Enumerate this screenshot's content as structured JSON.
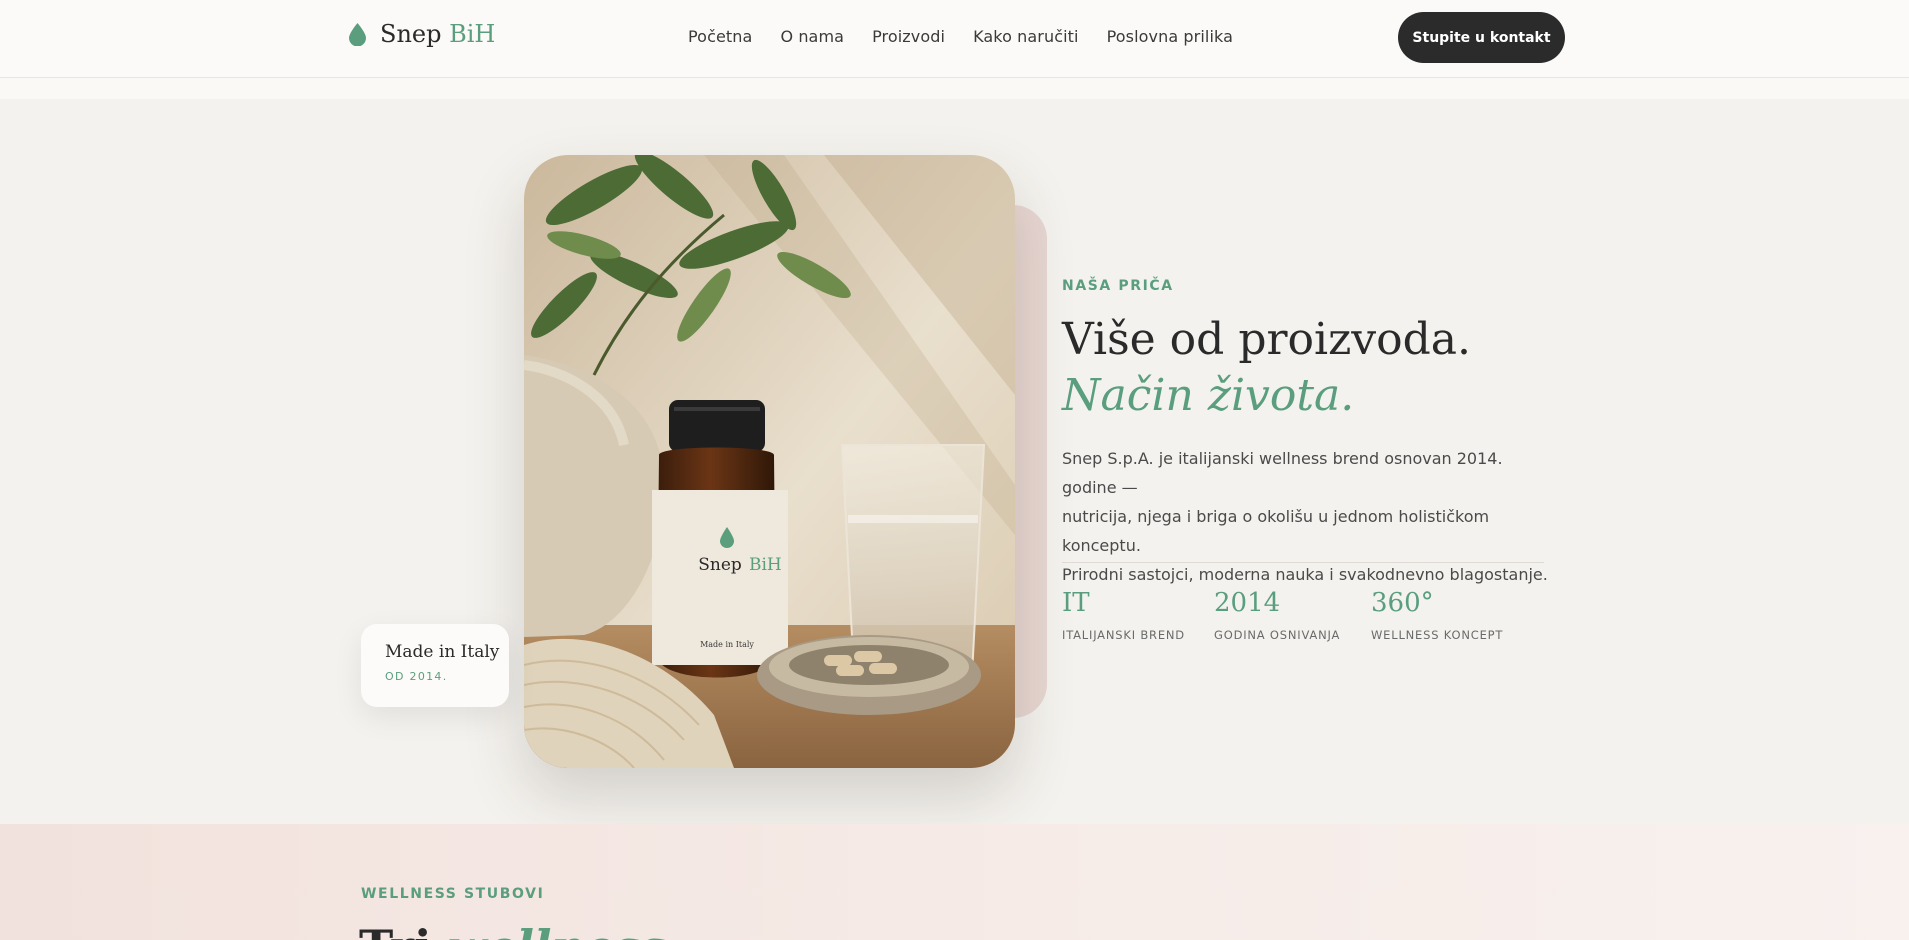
{
  "header": {
    "logo": {
      "name": "Snep",
      "accent": "BiH",
      "icon": "droplet-icon"
    },
    "nav": [
      "Početna",
      "O nama",
      "Proizvodi",
      "Kako naručiti",
      "Poslovna prilika"
    ],
    "cta_label": "Stupite u kontakt"
  },
  "story": {
    "eyebrow": "NAŠA PRIČA",
    "headline_main": "Više od proizvoda.",
    "headline_accent": "Način života.",
    "body_lines": [
      "Snep S.p.A. je italijanski wellness brend osnovan 2014. godine —",
      "nutricija, njega i briga o okolišu u jednom holističkom konceptu.",
      "Prirodni sastojci, moderna nauka i svakodnevno blagostanje."
    ],
    "stats": [
      {
        "value": "IT",
        "label": "ITALIJANSKI BREND"
      },
      {
        "value": "2014",
        "label": "GODINA OSNIVANJA"
      },
      {
        "value": "360°",
        "label": "WELLNESS KONCEPT"
      }
    ],
    "badge": {
      "title": "Made in Italy",
      "subtitle": "OD 2014."
    },
    "photo": {
      "bottle_brand": "Snep",
      "bottle_brand_accent": "BiH",
      "bottle_made_in": "Made in Italy"
    }
  },
  "pillars": {
    "eyebrow": "WELLNESS STUBOVI",
    "title_main": "Tri",
    "title_accent": "wellness"
  },
  "colors": {
    "accent": "#5a9e7e",
    "dark": "#2b2b2b",
    "background": "#f4f2ee",
    "pink": "#e7d6d1"
  }
}
